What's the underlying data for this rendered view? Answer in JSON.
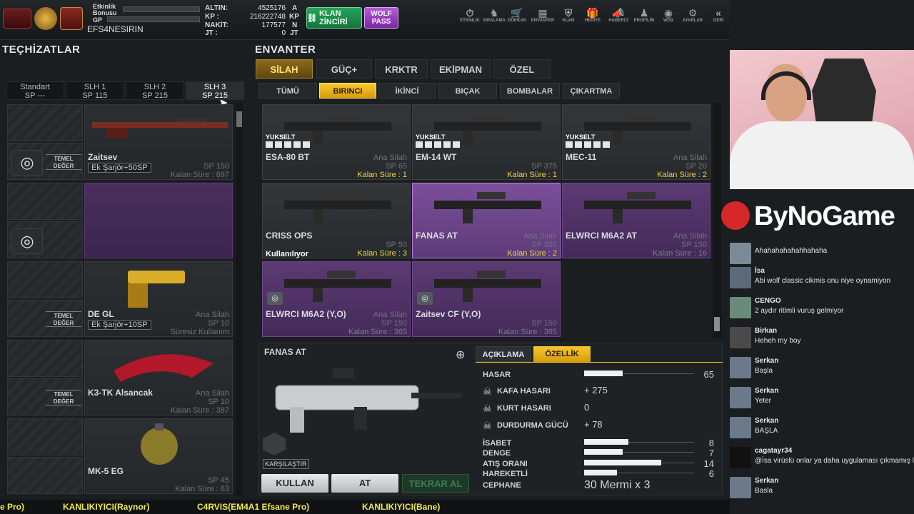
{
  "header": {
    "events_label": "Etkinlik",
    "bonus_label": "Bonusu",
    "gp_label": "GP",
    "player_name": "EFS4NESIRIN",
    "altin_label": "ALTIN:",
    "altin_value": "4525176",
    "altin_unit": "A",
    "kp_label": "KP :",
    "kp_value": "216222748",
    "kp_unit": "KP",
    "nakit_label": "NAKİT:",
    "nakit_value": "177577",
    "nakit_unit": "N",
    "jt_label": "JT :",
    "jt_value": "0",
    "jt_unit": "JT",
    "clan_chain_label": "KLAN ZİNCİRİ",
    "wolf_pass_line1": "WOLF",
    "wolf_pass_line2": "PASS",
    "nav": [
      {
        "icon": "stopwatch-icon",
        "glyph": "⏱",
        "label": "ETKİNLİK"
      },
      {
        "icon": "wolf-icon",
        "glyph": "♞",
        "label": "SIRALAMA"
      },
      {
        "icon": "cart-icon",
        "glyph": "🛒",
        "label": "DÜKKAN"
      },
      {
        "icon": "inventory-icon",
        "glyph": "▦",
        "label": "ENVANTER"
      },
      {
        "icon": "clan-shield-icon",
        "glyph": "⛨",
        "label": "KLAN"
      },
      {
        "icon": "gift-icon",
        "glyph": "🎁",
        "label": "HEDİYE"
      },
      {
        "icon": "megaphone-icon",
        "glyph": "📣",
        "label": "HABERCİ"
      },
      {
        "icon": "profile-icon",
        "glyph": "♟",
        "label": "PROFİLİM"
      },
      {
        "icon": "web-icon",
        "glyph": "◉",
        "label": "WEB"
      },
      {
        "icon": "gear-icon",
        "glyph": "⚙",
        "label": "AYARLAR"
      },
      {
        "icon": "back-icon",
        "glyph": "«",
        "label": "GERİ"
      }
    ]
  },
  "left": {
    "title": "TEÇHİZATLAR",
    "tabs": [
      {
        "name": "Standart",
        "sp": "SP ---"
      },
      {
        "name": "SLH 1",
        "sp": "SP 115"
      },
      {
        "name": "SLH 2",
        "sp": "SP 215"
      },
      {
        "name": "SLH 3",
        "sp": "SP 215"
      }
    ],
    "temel_line1": "TEMEL",
    "temel_line2": "DEĞER",
    "slots": [
      {
        "name": "Zaitsev",
        "extra": "Ek Şarjör+50SP",
        "type": "",
        "sp": "SP 150",
        "time": "Kalan Süre : 697"
      },
      {
        "name": "",
        "extra": "",
        "type": "",
        "sp": "",
        "time": ""
      },
      {
        "name": "DE GL",
        "extra": "Ek Şarjör+10SP",
        "type": "Ana Silah",
        "sp": "SP 10",
        "time": "Süresiz Kullanım"
      },
      {
        "name": "K3-TK Alsancak",
        "extra": "",
        "type": "Ana Silah",
        "sp": "SP 10",
        "time": "Kalan Süre : 387"
      },
      {
        "name": "MK-5 EG",
        "extra": "",
        "type": "",
        "sp": "SP 45",
        "time": "Kalan Süre : 63"
      }
    ]
  },
  "inventory": {
    "title": "ENVANTER",
    "tabs": [
      "SİLAH",
      "GÜÇ+",
      "KRKTR",
      "EKİPMAN",
      "ÖZEL"
    ],
    "subtabs": [
      "TÜMÜ",
      "BIRINCI",
      "İKİNCİ",
      "BIÇAK",
      "BOMBALAR",
      "ÇIKARTMA"
    ],
    "yuksel_label": "YUKSELT",
    "used_label": "Kullanılıyor",
    "items": [
      {
        "name": "ESA-80 BT",
        "type": "Ana Silah",
        "sp": "SP 65",
        "time": "Kalan Süre : 1"
      },
      {
        "name": "EM-14 WT",
        "type": "",
        "sp": "SP 375",
        "time": "Kalan Süre : 1"
      },
      {
        "name": "MEC-11",
        "type": "Ana Silah",
        "sp": "SP 20",
        "time": "Kalan Süre : 2"
      },
      {
        "name": "CRISS OPS",
        "type": "",
        "sp": "SP 50",
        "time": "Kalan Süre : 3"
      },
      {
        "name": "FANAS AT",
        "type": "Ana Silah",
        "sp": "SP 350",
        "time": "Kalan Süre : 2"
      },
      {
        "name": "ELWRCI M6A2 AT",
        "type": "Ana Silah",
        "sp": "SP 150",
        "time": "Kalan Süre : 16"
      },
      {
        "name": "ELWRCI M6A2 (Y,O)",
        "type": "Ana Silah",
        "sp": "SP 150",
        "time": "Kalan Süre : 365"
      },
      {
        "name": "Zaitsev CF (Y,O)",
        "type": "",
        "sp": "SP 150",
        "time": "Kalan Süre : 365"
      }
    ]
  },
  "detail": {
    "name": "FANAS AT",
    "tab_desc": "AÇIKLAMA",
    "tab_props": "ÖZELLİK",
    "compare_label": "KARŞILAŞTIR",
    "hasar_label": "HASAR",
    "hasar_value": "65",
    "hasar_fill": 0.35,
    "kafa_label": "KAFA HASARI",
    "kafa_value": "+ 275",
    "kurt_label": "KURT HASARI",
    "kurt_value": "0",
    "durdurma_label": "DURDURMA GÜCÜ",
    "durdurma_value": "+ 78",
    "isabet_label": "İSABET",
    "isabet_value": "8",
    "isabet_fill": 0.4,
    "denge_label": "DENGE",
    "denge_value": "7",
    "denge_fill": 0.35,
    "atis_label": "ATIŞ ORANI",
    "atis_value": "14",
    "atis_fill": 0.7,
    "hareketli_label": "HAREKETLİ",
    "hareketli_value": "6",
    "hareketli_fill": 0.3,
    "cephane_label": "CEPHANE",
    "cephane_value": "30 Mermi x 3",
    "btn_use": "KULLAN",
    "btn_drop": "AT",
    "btn_rebuy": "TEKRAR AL"
  },
  "stream": {
    "brand": "ByNoGame",
    "chat": [
      {
        "name": "",
        "text": "Ahahahahahahhahaha"
      },
      {
        "name": "İsa",
        "text": "Abi wolf classic cikmis onu niye oynamiyon"
      },
      {
        "name": "CENGO",
        "text": "2 aydır ritimli vuruş gelmiyor"
      },
      {
        "name": "Birkan",
        "text": "Heheh my boy"
      },
      {
        "name": "Serkan",
        "text": "Başla"
      },
      {
        "name": "Serkan",
        "text": "Yeter"
      },
      {
        "name": "Serkan",
        "text": "BAŞLA"
      },
      {
        "name": "cagatayr34",
        "text": "@İsa virüslü onlar ya daha uygulaması çıkmamış linki"
      },
      {
        "name": "Serkan",
        "text": "Basla"
      }
    ],
    "ticker": [
      "e Pro)",
      "KANLIKIYICI(Raynor)",
      "C4RVIS(EM4A1 Efsane Pro)",
      "KANLIKIYICI(Bane)"
    ]
  }
}
